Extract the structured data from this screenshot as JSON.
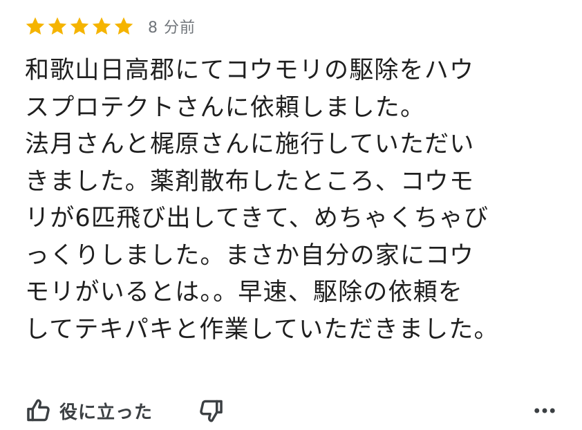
{
  "review": {
    "rating": 5,
    "rating_max": 5,
    "star_color": "#F5B400",
    "time_ago": "8 分前",
    "text_lines": [
      "和歌山日高郡にてコウモリの駆除をハウ",
      "スプロテクトさんに依頼しました。",
      "法月さんと梶原さんに施行していただい",
      "きました。薬剤散布したところ、コウモ",
      "リが6匹飛び出してきて、めちゃくちゃび",
      "っくりしました。まさか自分の家にコウ",
      "モリがいるとは。。早速、駆除の依頼を",
      "してテキパキと作業していただきました。"
    ]
  },
  "actions": {
    "helpful_label": "役に立った",
    "helpful_icon": "thumbs-up-icon",
    "not_helpful_icon": "thumbs-down-icon",
    "more_icon": "more-options-icon"
  }
}
